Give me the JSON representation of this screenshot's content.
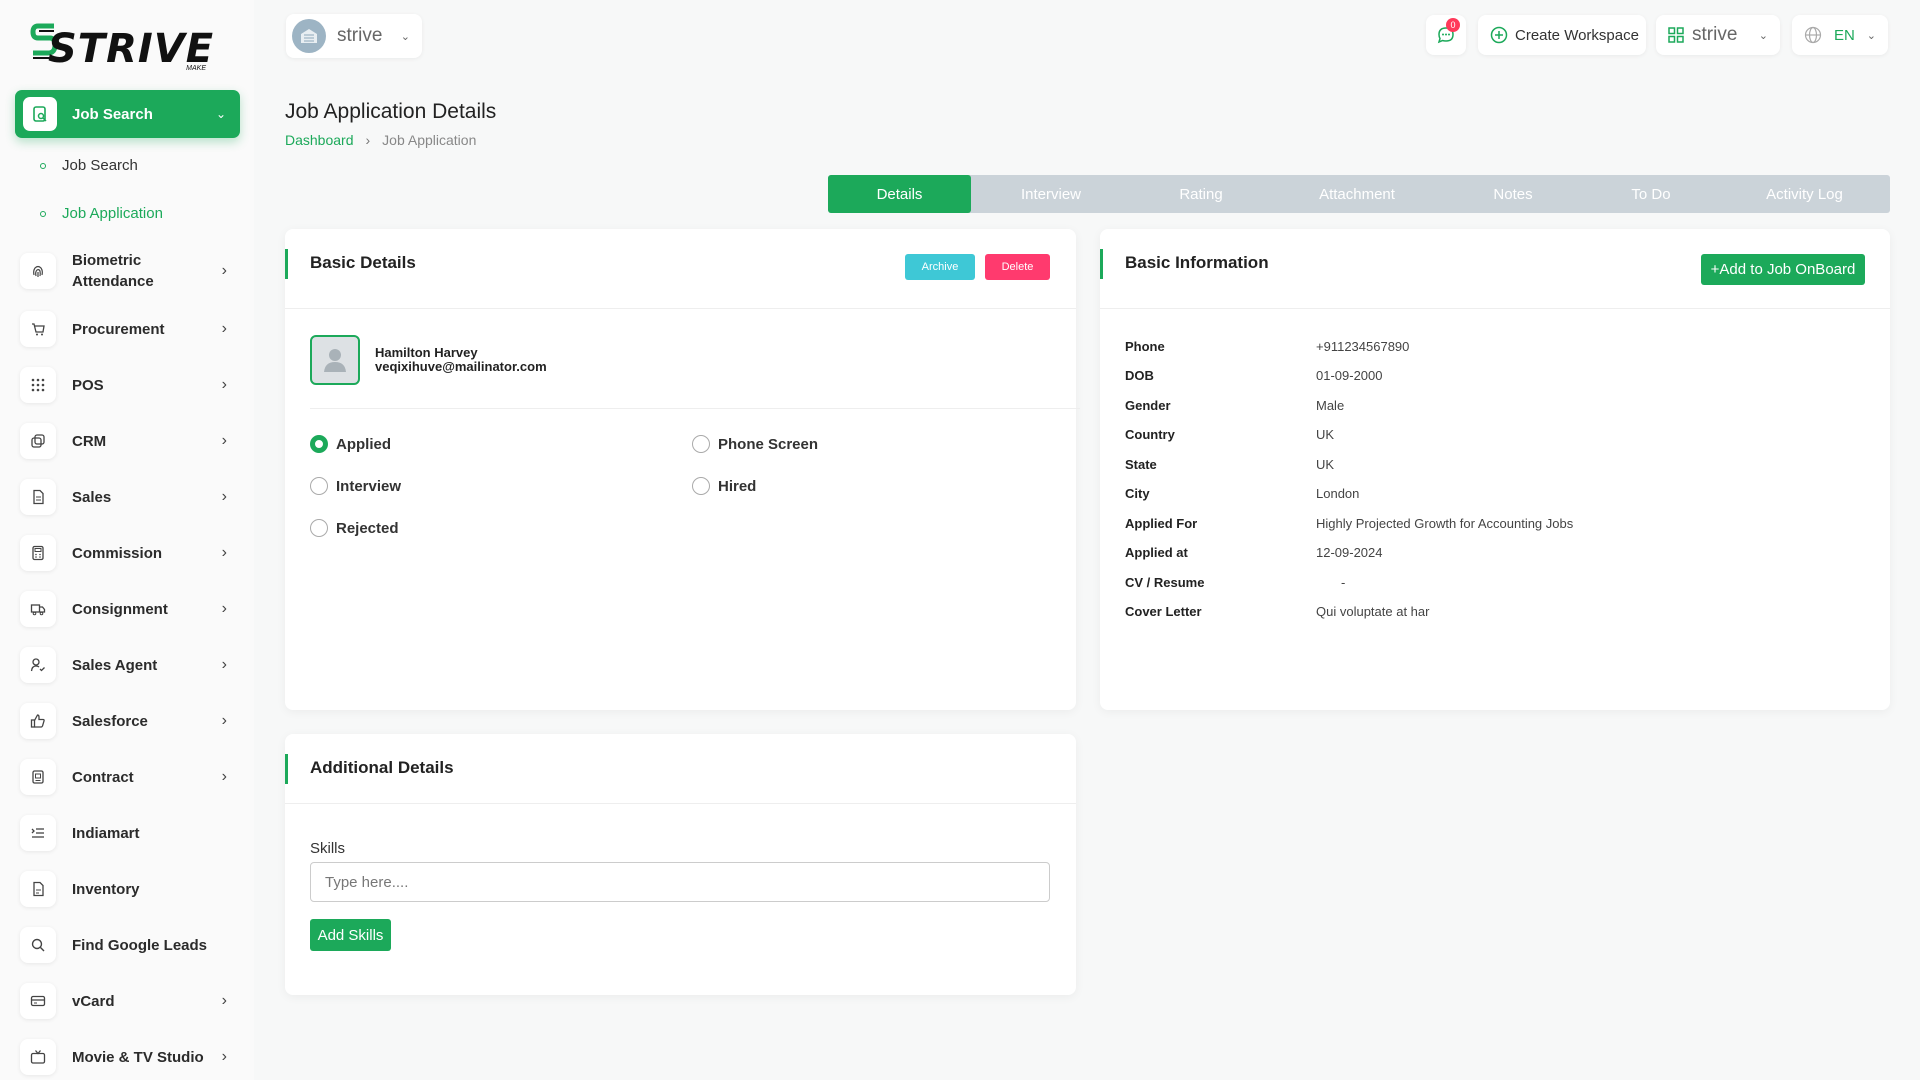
{
  "brand": {
    "logo_text": "STRIVE",
    "logo_sub": "MAKE"
  },
  "header": {
    "workspace_name": "strive",
    "notification_count": "0",
    "create_workspace": "Create Workspace",
    "workspace_switch": "strive",
    "language": "EN"
  },
  "sidebar": {
    "active": {
      "label": "Job Search",
      "icon": "job-search-icon"
    },
    "sub_items": [
      {
        "label": "Job Search",
        "active": false
      },
      {
        "label": "Job Application",
        "active": true
      }
    ],
    "items": [
      {
        "label": "Biometric Attendance",
        "icon": "fingerprint-icon",
        "has_children": true
      },
      {
        "label": "Procurement",
        "icon": "cart-icon",
        "has_children": true
      },
      {
        "label": "POS",
        "icon": "grid-icon",
        "has_children": true
      },
      {
        "label": "CRM",
        "icon": "crm-icon",
        "has_children": true
      },
      {
        "label": "Sales",
        "icon": "file-icon",
        "has_children": true
      },
      {
        "label": "Commission",
        "icon": "calculator-icon",
        "has_children": true
      },
      {
        "label": "Consignment",
        "icon": "truck-icon",
        "has_children": true
      },
      {
        "label": "Sales Agent",
        "icon": "user-check-icon",
        "has_children": true
      },
      {
        "label": "Salesforce",
        "icon": "thumbs-up-icon",
        "has_children": true
      },
      {
        "label": "Contract",
        "icon": "contract-icon",
        "has_children": true
      },
      {
        "label": "Indiamart",
        "icon": "list-icon",
        "has_children": false
      },
      {
        "label": "Inventory",
        "icon": "inventory-icon",
        "has_children": false
      },
      {
        "label": "Find Google Leads",
        "icon": "search-icon",
        "has_children": false
      },
      {
        "label": "vCard",
        "icon": "card-icon",
        "has_children": true
      },
      {
        "label": "Movie & TV Studio",
        "icon": "tv-icon",
        "has_children": true
      }
    ]
  },
  "page": {
    "title": "Job Application Details",
    "breadcrumb": {
      "home": "Dashboard",
      "current": "Job Application"
    }
  },
  "tabs": [
    {
      "label": "Details",
      "active": true
    },
    {
      "label": "Interview",
      "active": false
    },
    {
      "label": "Rating",
      "active": false
    },
    {
      "label": "Attachment",
      "active": false
    },
    {
      "label": "Notes",
      "active": false
    },
    {
      "label": "To Do",
      "active": false
    },
    {
      "label": "Activity Log",
      "active": false
    }
  ],
  "basic_details": {
    "title": "Basic Details",
    "archive_label": "Archive",
    "delete_label": "Delete",
    "applicant_name": "Hamilton Harvey",
    "applicant_email": "veqixihuve@mailinator.com",
    "stages": [
      {
        "label": "Applied",
        "checked": true
      },
      {
        "label": "Phone Screen",
        "checked": false
      },
      {
        "label": "Interview",
        "checked": false
      },
      {
        "label": "Hired",
        "checked": false
      },
      {
        "label": "Rejected",
        "checked": false
      }
    ]
  },
  "basic_information": {
    "title": "Basic Information",
    "onboard_label": "+Add to Job OnBoard",
    "rows": [
      {
        "key": "Phone",
        "value": "+911234567890"
      },
      {
        "key": "DOB",
        "value": "01-09-2000"
      },
      {
        "key": "Gender",
        "value": "Male"
      },
      {
        "key": "Country",
        "value": "UK"
      },
      {
        "key": "State",
        "value": "UK"
      },
      {
        "key": "City",
        "value": "London"
      },
      {
        "key": "Applied For",
        "value": "Highly Projected Growth for Accounting Jobs"
      },
      {
        "key": "Applied at",
        "value": "12-09-2024"
      },
      {
        "key": "CV / Resume",
        "value": "-"
      },
      {
        "key": "Cover Letter",
        "value": "Qui voluptate at har"
      }
    ]
  },
  "additional_details": {
    "title": "Additional Details",
    "skills_label": "Skills",
    "skills_placeholder": "Type here....",
    "add_skills_label": "Add Skills"
  },
  "colors": {
    "accent": "#1ca95a",
    "archive": "#3ec8d6",
    "delete": "#ff3a6e",
    "tab_bg": "#cbd3d9"
  }
}
